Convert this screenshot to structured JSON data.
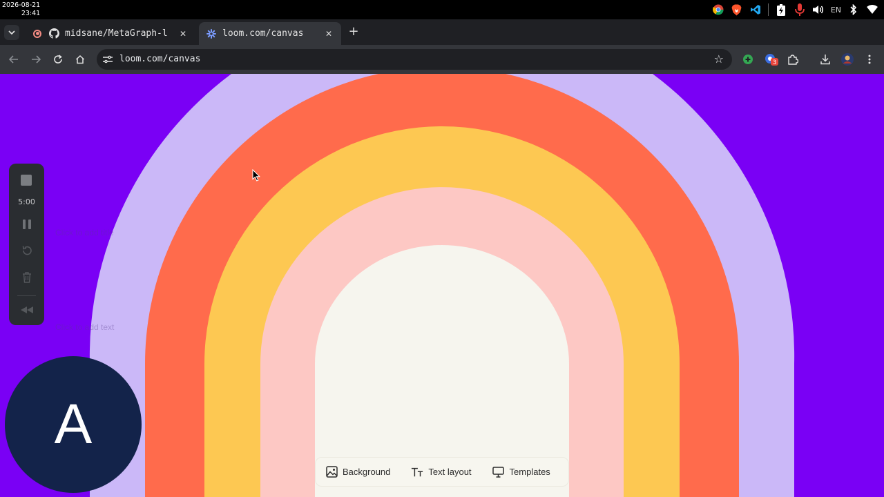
{
  "system": {
    "date": "2026-08-21",
    "time": "23:41",
    "tray_lang": "EN",
    "tray_icons": [
      "chrome-icon",
      "brave-icon",
      "vscode-icon",
      "battery-charging-icon",
      "microphone-icon",
      "volume-icon",
      "bluetooth-icon",
      "wifi-icon"
    ]
  },
  "tabs": [
    {
      "title": "midsane/MetaGraph-l",
      "icon": "github-icon",
      "active": false,
      "recording": true
    },
    {
      "title": "loom.com/canvas",
      "icon": "loom-icon",
      "active": true
    }
  ],
  "toolbar": {
    "url": "loom.com/canvas"
  },
  "canvas": {
    "placeholder_title": "Click to add title",
    "placeholder_text": "Click to add text",
    "colors": {
      "background": "#7a00f5",
      "band_lavender": "#cbb8f8",
      "band_coral": "#ff6b4c",
      "band_yellow": "#fdc852",
      "band_pink": "#fdc8c4",
      "center": "#f6f5ee"
    }
  },
  "recorder": {
    "timer": "5:00",
    "controls": [
      "stop-icon",
      "pause-icon",
      "restart-icon",
      "delete-icon",
      "rewind-icon"
    ]
  },
  "avatar": {
    "initial": "A"
  },
  "bottom_toolbar": {
    "background_label": "Background",
    "text_layout_label": "Text layout",
    "templates_label": "Templates"
  }
}
